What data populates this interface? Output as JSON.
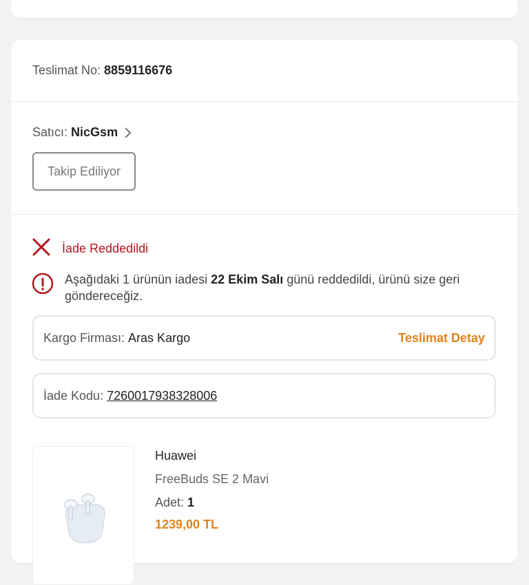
{
  "delivery": {
    "label": "Teslimat No:",
    "number": "8859116676"
  },
  "seller": {
    "label": "Satıcı:",
    "name": "NicGsm",
    "follow_button": "Takip Ediliyor"
  },
  "status": {
    "icon": "close-x-icon",
    "label": "İade Reddedildi",
    "color": "#b3141c"
  },
  "notice": {
    "icon": "info-circle-icon",
    "text_before": "Aşağıdaki 1 ürünün iadesi ",
    "date": "22 Ekim Salı",
    "text_after": " günü reddedildi, ürünü size geri göndereceğiz."
  },
  "cargo": {
    "label": "Kargo Firması:",
    "company": "Aras Kargo",
    "detail_link": "Teslimat Detay"
  },
  "return_code": {
    "label": "İade Kodu:",
    "code": "7260017938328006"
  },
  "product": {
    "brand": "Huawei",
    "name": "FreeBuds SE 2 Mavi",
    "qty_label": "Adet:",
    "qty": "1",
    "price": "1239,00 TL",
    "image_icon": "earbuds-image"
  },
  "colors": {
    "accent": "#e0841c",
    "danger": "#b3141c",
    "background": "#f2f2f2"
  }
}
